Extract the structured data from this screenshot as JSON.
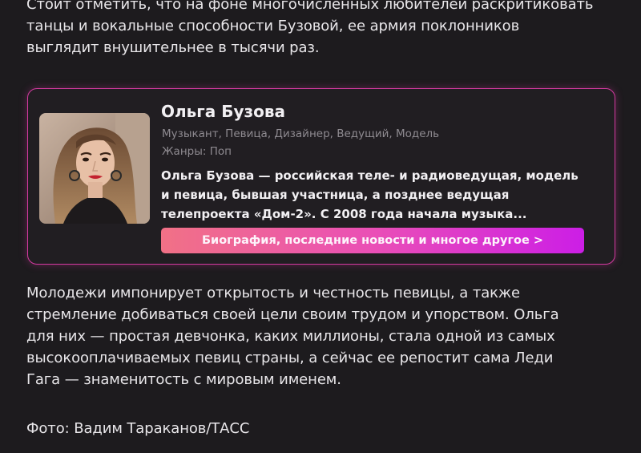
{
  "article": {
    "intro_lines": [
      "Стоит отметить, что на фоне многочисленных любителей раскритиковать",
      "танцы и вокальные способности Бузовой, ее армия поклонников",
      "выглядит внушительнее в тысячи раз."
    ],
    "body_lines": [
      "Молодежи импонирует открытость и честность певицы, а также",
      "стремление добиваться своей цели своим трудом и упорством. Ольга",
      "для них — простая девчонка, каких миллионы, стала одной из самых",
      "высокооплачиваемых певиц страны, а сейчас ее репостит сама Леди",
      "Гага — знаменитость с мировым именем."
    ],
    "photo_credit": "Фото: Вадим Тараканов/ТАСС"
  },
  "person_card": {
    "name": "Ольга Бузова",
    "professions": "Музыкант, Певица, Дизайнер, Ведущий, Модель",
    "genres": "Жанры: Поп",
    "description_lines": [
      "Ольга Бузова — российская теле- и радиоведущая, модель",
      "и певица, бывшая участница, а позднее ведущая",
      "телепроекта «Дом-2». С 2008 года начала музыка..."
    ],
    "button_label": "Биография, последние новости и многое другое >",
    "accent_color": "#d43aa0"
  }
}
